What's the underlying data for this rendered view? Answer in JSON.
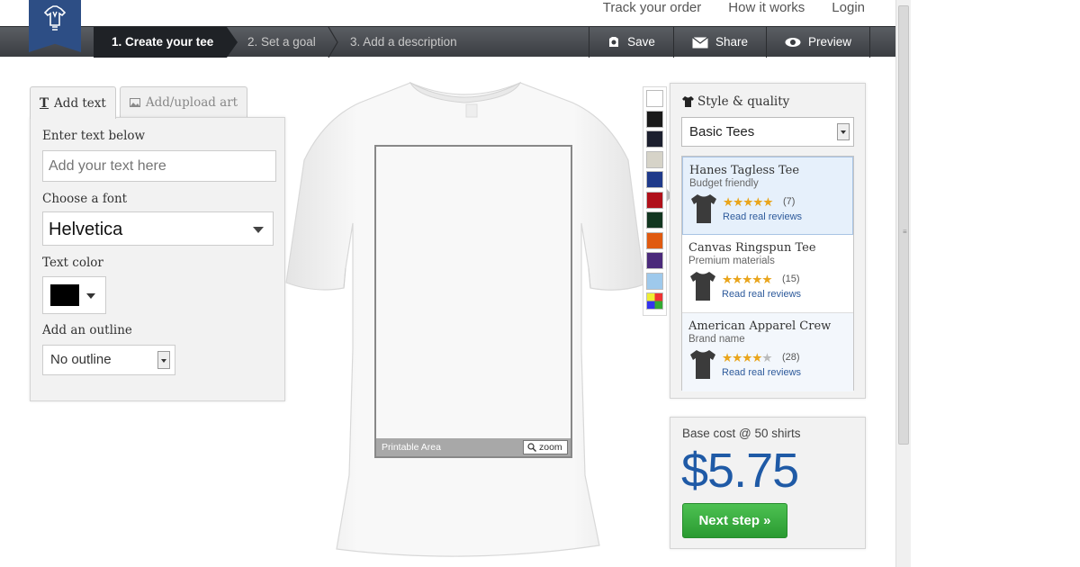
{
  "header": {
    "links": [
      "Track your order",
      "How it works",
      "Login"
    ]
  },
  "steps": [
    {
      "label": "1. Create your tee",
      "active": true
    },
    {
      "label": "2. Set a goal",
      "active": false
    },
    {
      "label": "3. Add a description",
      "active": false
    }
  ],
  "actions": {
    "save": "Save",
    "share": "Share",
    "preview": "Preview"
  },
  "left_panel": {
    "tab_text": "Add text",
    "tab_art": "Add/upload art",
    "enter_text_label": "Enter text below",
    "text_placeholder": "Add your text here",
    "font_label": "Choose a font",
    "font_value": "Helvetica",
    "color_label": "Text color",
    "color_value": "#000000",
    "outline_label": "Add an outline",
    "outline_value": "No outline"
  },
  "canvas": {
    "printable_label": "Printable Area",
    "zoom_label": "zoom"
  },
  "swatches": [
    "#ffffff",
    "#1a1a1a",
    "#1c1f2e",
    "#d6d3c8",
    "#1f3a8a",
    "#b0101a",
    "#123620",
    "#e05a10",
    "#4b2a7b",
    "#9ec9ec",
    "multicolor"
  ],
  "style_panel": {
    "title": "Style & quality",
    "selected_style": "Basic Tees",
    "products": [
      {
        "name": "Hanes Tagless Tee",
        "subtitle": "Budget friendly",
        "rating": 5,
        "count": "(7)",
        "reviews_label": "Read real reviews",
        "selected": true
      },
      {
        "name": "Canvas Ringspun Tee",
        "subtitle": "Premium materials",
        "rating": 5,
        "count": "(15)",
        "reviews_label": "Read real reviews",
        "selected": false
      },
      {
        "name": "American Apparel Crew",
        "subtitle": "Brand name",
        "rating": 4,
        "count": "(28)",
        "reviews_label": "Read real reviews",
        "selected": false
      }
    ]
  },
  "cost": {
    "label": "Base cost @ 50 shirts",
    "price": "$5.75",
    "next_label": "Next step »"
  }
}
